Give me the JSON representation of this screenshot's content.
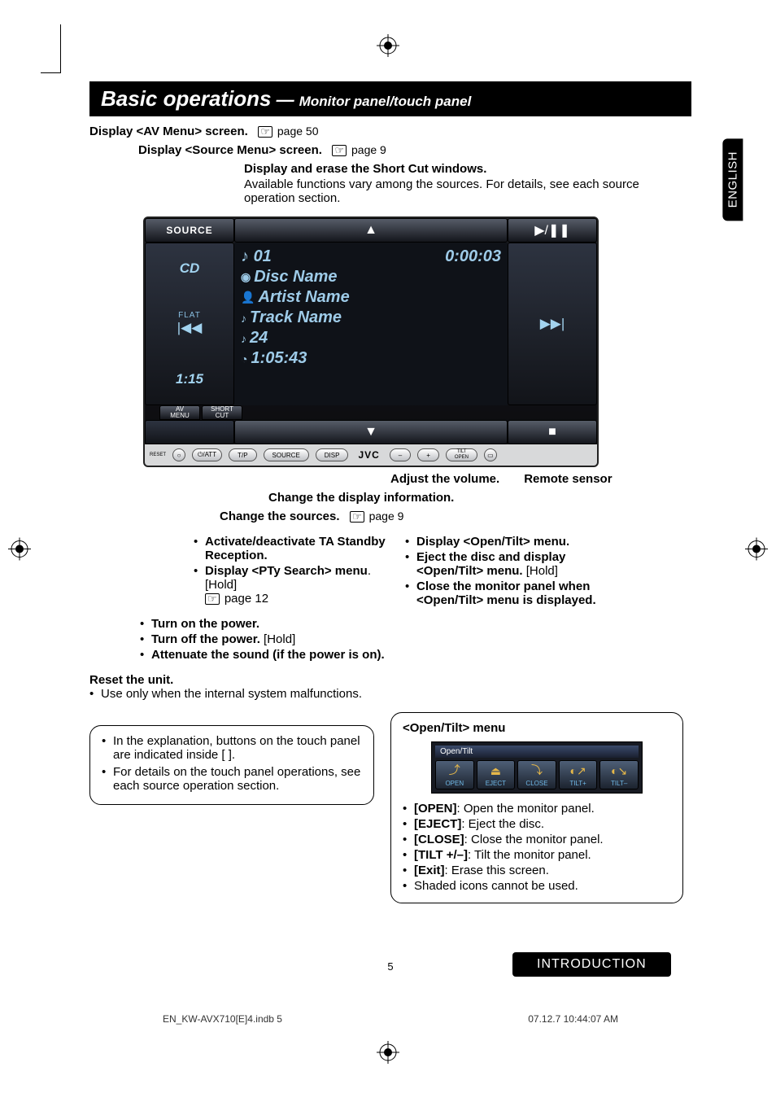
{
  "title": {
    "main": "Basic operations",
    "dash": " — ",
    "sub": "Monitor panel/touch panel"
  },
  "lang_tab": "ENGLISH",
  "intro": {
    "line1_bold": "Display <AV Menu> screen.",
    "line1_ref": "page 50",
    "line2_bold": "Display <Source Menu> screen.",
    "line2_ref": "page 9",
    "line3_bold": "Display and erase the Short Cut windows.",
    "line3_body": "Available functions vary among the sources. For details, see each source operation section."
  },
  "device": {
    "source_btn": "SOURCE",
    "top_arrow": "▲",
    "play_pause": "▶/❚❚",
    "left_col": {
      "cd": "CD",
      "flat": "FLAT",
      "prev_icon": "|◀◀",
      "clock": "1:15"
    },
    "center": {
      "track_no_icon": "♪",
      "track_no": "01",
      "elapsed": "0:00:03",
      "disc_icon": "◉",
      "disc": "Disc Name",
      "artist_icon": "👤",
      "artist": "Artist Name",
      "track_icon": "♪",
      "track": "Track Name",
      "count_icon": "♪",
      "count": "24",
      "total_icon": "◔",
      "total": "1:05:43"
    },
    "right_col": {
      "next_icon": "▶▶|"
    },
    "bot_arrow": "▼",
    "stop_icon": "■",
    "tabs": {
      "av": "AV\nMENU",
      "short": "SHORT\nCUT"
    },
    "hw": {
      "reset": "RESET",
      "power": "⏻/ATT",
      "tp": "T/P",
      "source": "SOURCE",
      "disp": "DISP",
      "jvc": "JVC",
      "minus": "–",
      "plus": "+",
      "tilt": "TILT\nOPEN",
      "sensor": "▢"
    }
  },
  "callouts": {
    "volume": "Adjust the volume.",
    "remote": "Remote sensor",
    "disp_info": "Change the display information.",
    "change_src": "Change the sources.",
    "change_src_ref": "page 9"
  },
  "tp_list": [
    {
      "bold": "Activate/deactivate TA Standby Reception.",
      "plain": ""
    },
    {
      "bold": "Display <PTy Search> menu",
      "plain": ". [Hold]",
      "ref": "page 12"
    }
  ],
  "tilt_list": [
    {
      "bold": "Display <Open/Tilt> menu.",
      "plain": ""
    },
    {
      "bold": "Eject the disc and display <Open/Tilt> menu.",
      "plain": " [Hold]"
    },
    {
      "bold": "Close the monitor panel when <Open/Tilt> menu is displayed.",
      "plain": ""
    }
  ],
  "power_list": [
    {
      "bold": "Turn on the power.",
      "plain": ""
    },
    {
      "bold": "Turn off the power.",
      "plain": " [Hold]"
    },
    {
      "bold": "Attenuate the sound (if the power is on).",
      "plain": ""
    }
  ],
  "reset": {
    "head": "Reset the unit.",
    "item": "Use only when the internal system malfunctions."
  },
  "explain": [
    "In the explanation, buttons on the touch panel are indicated inside [      ].",
    "For details on the touch panel operations, see each source operation section."
  ],
  "open_tilt": {
    "head": "<Open/Tilt> menu",
    "panel_title": "Open/Tilt",
    "buttons": [
      {
        "icon": "⤴",
        "label": "OPEN"
      },
      {
        "icon": "⏏",
        "label": "EJECT"
      },
      {
        "icon": "⤵",
        "label": "CLOSE"
      },
      {
        "icon": "◐↗",
        "label": "TILT+"
      },
      {
        "icon": "◐↘",
        "label": "TILT–"
      }
    ],
    "items": [
      {
        "bold": "[OPEN]",
        "plain": ": Open the monitor panel."
      },
      {
        "bold": "[EJECT]",
        "plain": ": Eject the disc."
      },
      {
        "bold": "[CLOSE]",
        "plain": ": Close the monitor panel."
      },
      {
        "bold": "[TILT +/–]",
        "plain": ": Tilt the monitor panel."
      },
      {
        "bold": "[Exit]",
        "plain": ": Erase this screen."
      },
      {
        "bold": "",
        "plain": "Shaded icons cannot be used."
      }
    ]
  },
  "page_number": "5",
  "section_tab": "INTRODUCTION",
  "footer": {
    "left": "EN_KW-AVX710[E]4.indb   5",
    "right": "07.12.7   10:44:07 AM"
  }
}
